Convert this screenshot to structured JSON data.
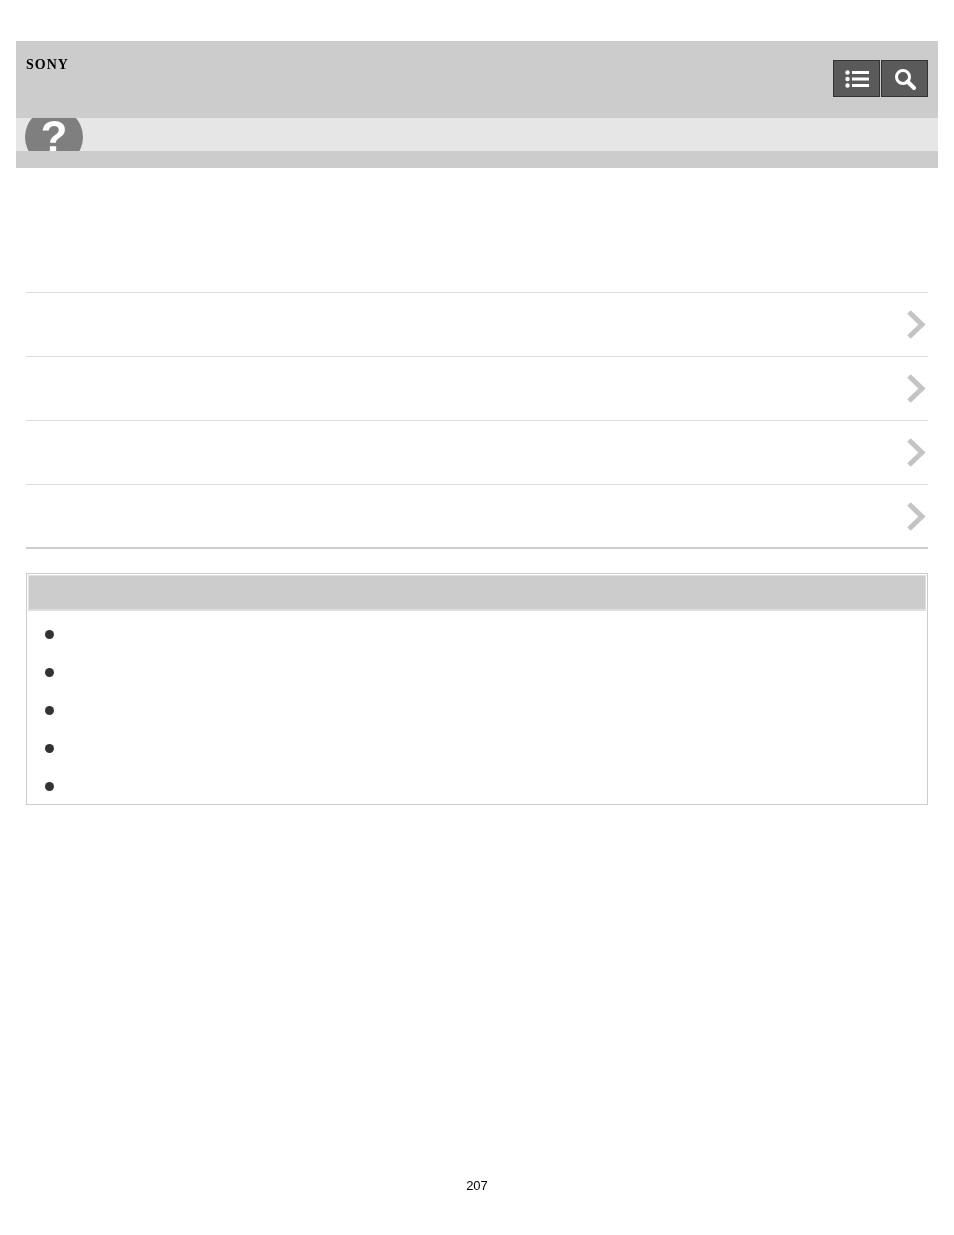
{
  "header": {
    "brand": "SONY",
    "buttons": [
      {
        "kind": "contents"
      },
      {
        "kind": "search"
      }
    ],
    "help_badge": "?"
  },
  "link_rows": [
    {
      "kind": "link"
    },
    {
      "kind": "link"
    },
    {
      "kind": "link"
    },
    {
      "kind": "link"
    }
  ],
  "related_box": {
    "items": [
      {
        "kind": "bullet"
      },
      {
        "kind": "bullet"
      },
      {
        "kind": "bullet"
      },
      {
        "kind": "bullet"
      },
      {
        "kind": "bullet"
      }
    ]
  },
  "page_number": "207"
}
